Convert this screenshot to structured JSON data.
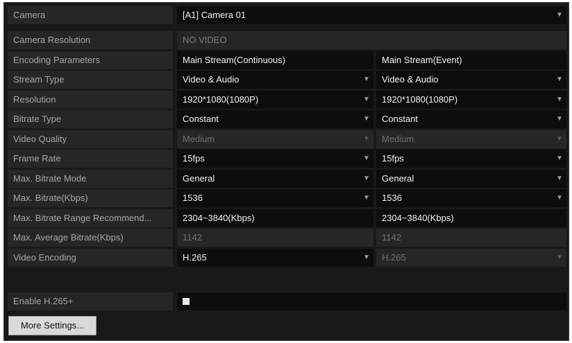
{
  "camera": {
    "label": "Camera",
    "value": "[A1] Camera 01"
  },
  "resolution_info": {
    "label": "Camera Resolution",
    "value": "NO VIDEO"
  },
  "encoding_header": {
    "label": "Encoding Parameters",
    "main_continuous": "Main Stream(Continuous)",
    "main_event": "Main Stream(Event)"
  },
  "stream_type": {
    "label": "Stream Type",
    "continuous": "Video & Audio",
    "event": "Video & Audio"
  },
  "resolution": {
    "label": "Resolution",
    "continuous": "1920*1080(1080P)",
    "event": "1920*1080(1080P)"
  },
  "bitrate_type": {
    "label": "Bitrate Type",
    "continuous": "Constant",
    "event": "Constant"
  },
  "video_quality": {
    "label": "Video Quality",
    "continuous": "Medium",
    "event": "Medium"
  },
  "frame_rate": {
    "label": "Frame Rate",
    "continuous": "15fps",
    "event": "15fps"
  },
  "max_bitrate_mode": {
    "label": "Max. Bitrate Mode",
    "continuous": "General",
    "event": "General"
  },
  "max_bitrate": {
    "label": "Max. Bitrate(Kbps)",
    "continuous": "1536",
    "event": "1536"
  },
  "max_bitrate_range": {
    "label": "Max. Bitrate Range Recommend...",
    "continuous": "2304~3840(Kbps)",
    "event": "2304~3840(Kbps)"
  },
  "max_avg_bitrate": {
    "label": "Max. Average Bitrate(Kbps)",
    "continuous": "1142",
    "event": "1142"
  },
  "video_encoding": {
    "label": "Video Encoding",
    "continuous": "H.265",
    "event": "H.265"
  },
  "enable_h265plus": {
    "label": "Enable H.265+",
    "checked": true
  },
  "more_settings": {
    "label": "More Settings..."
  },
  "icons": {
    "dropdown": "chevron-down-icon"
  },
  "colors": {
    "panel_bg": "#191919",
    "label_bg": "#262626",
    "field_bg": "#0d0d0d",
    "button_bg": "#d9d9d9"
  }
}
